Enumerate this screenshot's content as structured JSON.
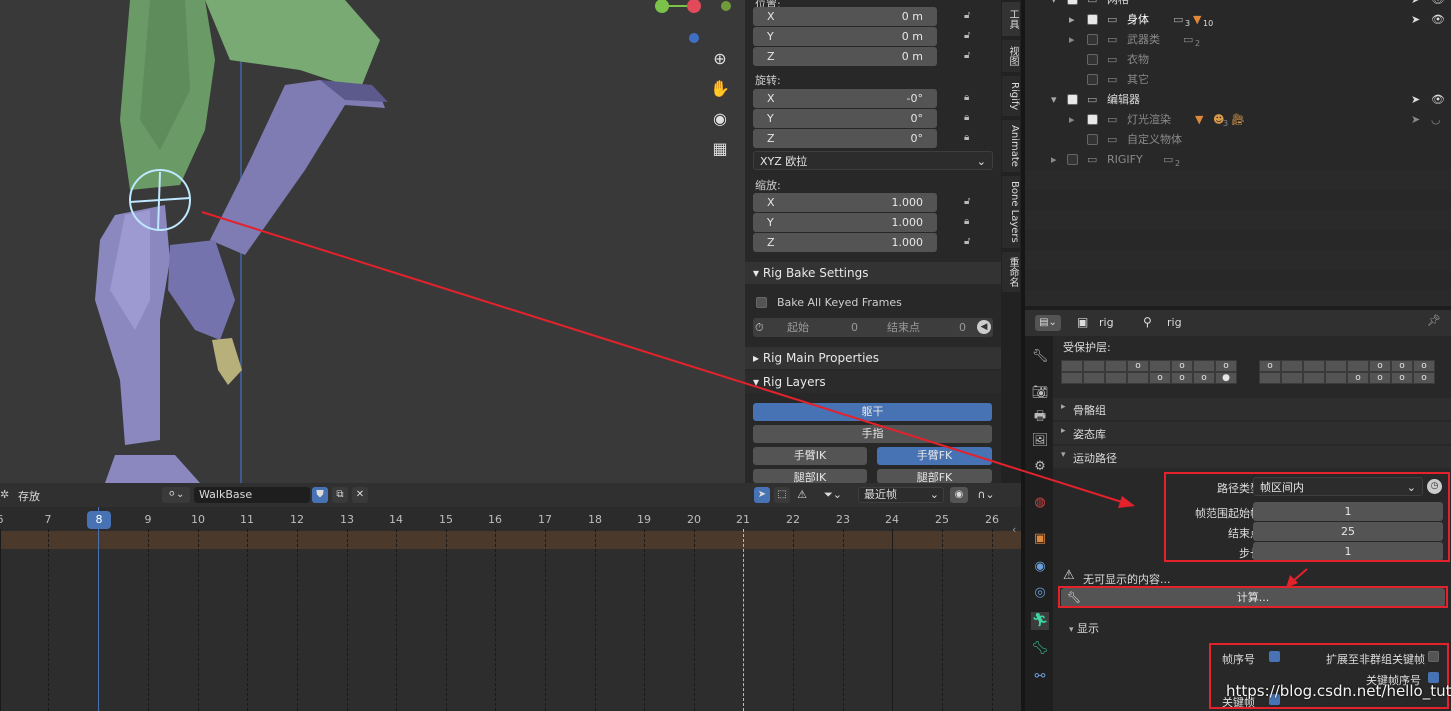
{
  "colors": {
    "accent": "#4772b3",
    "annotation": "#e3222c",
    "viewport_bg": "#393939",
    "panel_bg": "#282828"
  },
  "npanel": {
    "location_label": "位置:",
    "location": [
      {
        "axis": "X",
        "value": "0 m"
      },
      {
        "axis": "Y",
        "value": "0 m"
      },
      {
        "axis": "Z",
        "value": "0 m"
      }
    ],
    "rotation_label": "旋转:",
    "rotation": [
      {
        "axis": "X",
        "value": "-0°"
      },
      {
        "axis": "Y",
        "value": "0°"
      },
      {
        "axis": "Z",
        "value": "0°"
      }
    ],
    "rotation_mode": "XYZ 欧拉",
    "scale_label": "缩放:",
    "scale": [
      {
        "axis": "X",
        "value": "1.000"
      },
      {
        "axis": "Y",
        "value": "1.000"
      },
      {
        "axis": "Z",
        "value": "1.000"
      }
    ],
    "bake_header": "Rig Bake Settings",
    "bake_all": "Bake All Keyed Frames",
    "bake_start_label": "起始",
    "bake_start_value": "0",
    "bake_end_label": "结束点",
    "bake_end_value": "0",
    "main_props": "Rig Main Properties",
    "rig_layers": "Rig Layers",
    "layer_torso": "躯干",
    "layer_fingers": "手指",
    "layer_arm_ik": "手臂IK",
    "layer_arm_fk": "手臂FK",
    "layer_leg_ik": "腿部IK",
    "layer_leg_fk": "腿部FK"
  },
  "ntabs": [
    "工具",
    "视图",
    "Rigify",
    "Animate",
    "Bone Layers",
    "重命名"
  ],
  "outliner": {
    "rows": [
      {
        "name": "网格",
        "visible": true
      },
      {
        "name": "身体",
        "count1": "3",
        "count2": "10"
      },
      {
        "name": "武器类",
        "count1": "2"
      },
      {
        "name": "衣物"
      },
      {
        "name": "其它"
      },
      {
        "name": "编辑器"
      },
      {
        "name": "灯光渲染",
        "count1": "3"
      },
      {
        "name": "自定义物体"
      },
      {
        "name": "RIGIFY",
        "count1": "2"
      }
    ]
  },
  "props": {
    "breadcrumb_object": "rig",
    "breadcrumb_data": "rig",
    "protected_layers": "受保护层:",
    "bone_groups": "骨骼组",
    "pose_library": "姿态库",
    "motion_paths": "运动路径",
    "path_type_label": "路径类型",
    "path_type_value": "帧区间内",
    "frame_start_label": "帧范围起始帧",
    "frame_start_value": "1",
    "frame_end_label": "结束点",
    "frame_end_value": "25",
    "step_label": "步长",
    "step_value": "1",
    "warning": "无可显示的内容...",
    "calculate": "计算...",
    "display": "显示",
    "frame_numbers": "帧序号",
    "show_non_grouped": "扩展至非群组关键帧",
    "keyframe_numbers": "关键帧序号",
    "keyframes": "关键帧"
  },
  "timeline": {
    "mode": "存放",
    "action_name": "WalkBase",
    "nearest": "最近帧",
    "current_frame": "8",
    "ticks": [
      "6",
      "7",
      "8",
      "9",
      "10",
      "11",
      "12",
      "13",
      "14",
      "15",
      "16",
      "17",
      "18",
      "19",
      "20",
      "21",
      "22",
      "23",
      "24",
      "25",
      "26"
    ]
  },
  "watermark": "https://blog.csdn.net/hello_tute"
}
